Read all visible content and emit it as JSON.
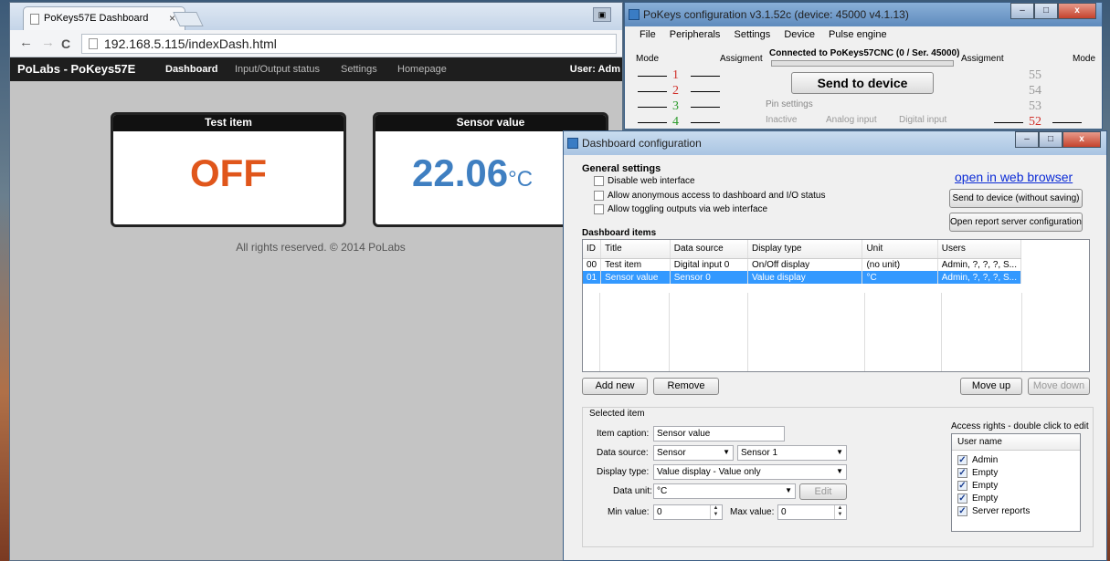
{
  "browser": {
    "tab_title": "PoKeys57E Dashboard",
    "tab_close": "×",
    "back": "←",
    "forward": "→",
    "reload": "C",
    "url": "192.168.5.115/indexDash.html",
    "mini_label": "▣"
  },
  "web": {
    "brand": "PoLabs - PoKeys57E",
    "nav": [
      "Dashboard",
      "Input/Output status",
      "Settings",
      "Homepage"
    ],
    "user": "User: Adm",
    "cards": [
      {
        "title": "Test item",
        "value": "OFF",
        "unit": "",
        "color": "#e0561b"
      },
      {
        "title": "Sensor value",
        "value": "22.06",
        "unit": "°C",
        "color": "#3f7fc1"
      }
    ],
    "footer": "All rights reserved. © 2014 PoLabs"
  },
  "pokeys": {
    "title": "PoKeys configuration v3.1.52c (device: 45000 v4.1.13)",
    "menu": [
      "File",
      "Peripherals",
      "Settings",
      "Device",
      "Pulse engine"
    ],
    "mode_left": "Mode",
    "assign_left": "Assigment",
    "connected": "Connected to PoKeys57CNC (0 / Ser. 45000)",
    "assign_right": "Assigment",
    "mode_right": "Mode",
    "send": "Send to device",
    "pin_settings": "Pin settings",
    "radios": [
      "Inactive",
      "Analog input",
      "Digital input"
    ],
    "pins_left": [
      "1",
      "2",
      "3",
      "4"
    ],
    "pins_right": [
      "55",
      "54",
      "53",
      "52"
    ],
    "win_min": "–",
    "win_max": "□",
    "win_close": "x"
  },
  "dashcfg": {
    "title": "Dashboard configuration",
    "general": "General settings",
    "checks": [
      "Disable web interface",
      "Allow anonymous access to dashboard and I/O status",
      "Allow toggling outputs via web interface"
    ],
    "open_browser": "open in web browser",
    "send_nosave": "Send to device (without saving)",
    "open_report": "Open report server configuration",
    "items_header": "Dashboard items",
    "columns": [
      "ID",
      "Title",
      "Data source",
      "Display type",
      "Unit",
      "Users"
    ],
    "rows": [
      [
        "00",
        "Test item",
        "Digital input 0",
        "On/Off display",
        "(no unit)",
        "Admin, ?, ?, ?, S..."
      ],
      [
        "01",
        "Sensor value",
        "Sensor 0",
        "Value display",
        "°C",
        "Admin, ?, ?, ?, S..."
      ]
    ],
    "add_new": "Add new",
    "remove": "Remove",
    "move_up": "Move up",
    "move_down": "Move down",
    "selected_item": "Selected item",
    "caption_lbl": "Item caption:",
    "caption_val": "Sensor value",
    "source_lbl": "Data source:",
    "source_val": "Sensor",
    "source_val2": "Sensor 1",
    "display_lbl": "Display type:",
    "display_val": "Value display - Value only",
    "unit_lbl": "Data unit:",
    "unit_val": "°C",
    "edit": "Edit",
    "min_lbl": "Min value:",
    "min_val": "0",
    "max_lbl": "Max value:",
    "max_val": "0",
    "access_lbl": "Access rights - double click to edit",
    "user_col": "User name",
    "users": [
      "Admin",
      "Empty",
      "Empty",
      "Empty",
      "Server reports"
    ]
  }
}
